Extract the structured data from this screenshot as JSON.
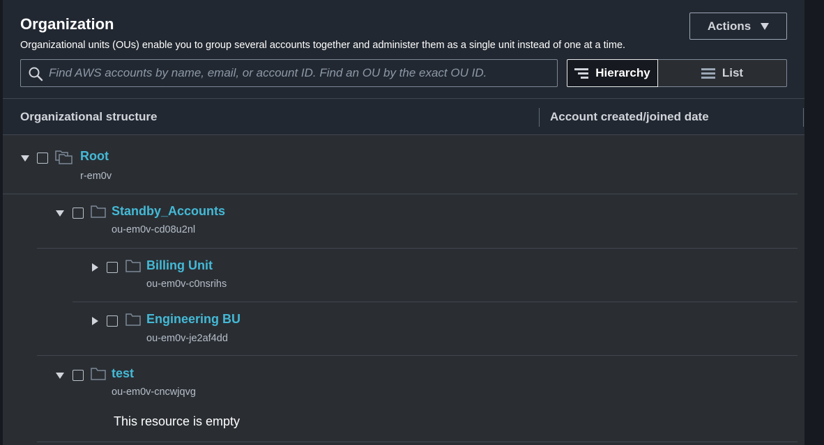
{
  "header": {
    "title": "Organization",
    "description": "Organizational units (OUs) enable you to group several accounts together and administer them as a single unit instead of one at a time.",
    "actions_label": "Actions"
  },
  "search": {
    "placeholder": "Find AWS accounts by name, email, or account ID. Find an OU by the exact OU ID.",
    "value": ""
  },
  "view_toggle": {
    "hierarchy_label": "Hierarchy",
    "list_label": "List",
    "selected": "Hierarchy"
  },
  "table": {
    "columns": [
      "Organizational structure",
      "Account created/joined date"
    ]
  },
  "tree": [
    {
      "name": "Root",
      "id": "r-em0v",
      "expanded": true,
      "icon": "root-icon"
    },
    {
      "name": "Standby_Accounts",
      "id": "ou-em0v-cd08u2nl",
      "expanded": true,
      "icon": "folder-icon"
    },
    {
      "name": "Billing Unit",
      "id": "ou-em0v-c0nsrihs",
      "expanded": false,
      "icon": "folder-icon"
    },
    {
      "name": "Engineering BU",
      "id": "ou-em0v-je2af4dd",
      "expanded": false,
      "icon": "folder-icon"
    },
    {
      "name": "test",
      "id": "ou-em0v-cncwjqvg",
      "expanded": true,
      "icon": "folder-icon"
    }
  ],
  "empty_message": "This resource is empty",
  "colors": {
    "link": "#44b9d6",
    "background": "#2a2e33",
    "header_bg": "#222831"
  }
}
